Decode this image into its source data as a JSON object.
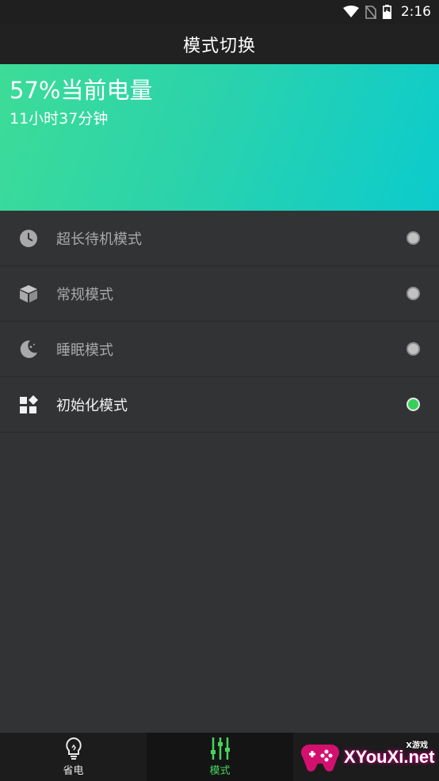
{
  "status_bar": {
    "time": "2:16",
    "icons": [
      "wifi-icon",
      "no-sim-icon",
      "battery-charging-icon"
    ]
  },
  "app_bar": {
    "title": "模式切换"
  },
  "hero": {
    "battery": "57%当前电量",
    "remaining": "11小时37分钟"
  },
  "modes": [
    {
      "label": "超长待机模式",
      "icon": "clock-icon",
      "selected": false
    },
    {
      "label": "常规模式",
      "icon": "cube-icon",
      "selected": false
    },
    {
      "label": "睡眠模式",
      "icon": "moon-icon",
      "selected": false
    },
    {
      "label": "初始化模式",
      "icon": "widgets-icon",
      "selected": true
    }
  ],
  "bottom_nav": [
    {
      "label": "省电",
      "icon": "lightbulb-icon",
      "active": false
    },
    {
      "label": "模式",
      "icon": "sliders-icon",
      "active": true
    }
  ],
  "watermark": {
    "text": "XYouXi.net",
    "small": "X游戏"
  },
  "colors": {
    "accent": "#35d05a",
    "hero_start": "#3ddc97",
    "hero_end": "#0ccbcd",
    "background": "#323335"
  }
}
